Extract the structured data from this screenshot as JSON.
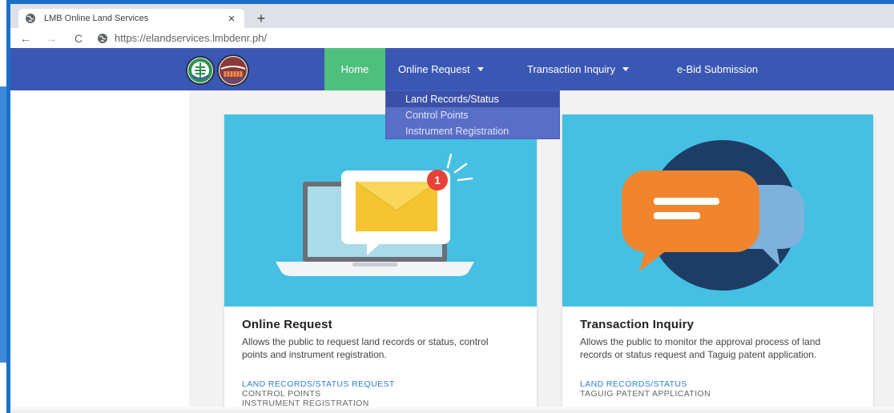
{
  "browser": {
    "tab_title": "LMB Online Land Services",
    "tab_close": "×",
    "new_tab": "+",
    "back": "←",
    "forward": "→",
    "reload": "C",
    "url": "https://elandservices.lmbdenr.ph/"
  },
  "navbar": {
    "home": "Home",
    "online_request": "Online Request",
    "transaction_inquiry": "Transaction Inquiry",
    "ebid": "e-Bid Submission"
  },
  "dropdown": {
    "items": [
      "Land Records/Status",
      "Control Points",
      "Instrument Registration"
    ]
  },
  "cards": [
    {
      "title": "Online Request",
      "description": "Allows the public to request land records or status, control points and instrument registration.",
      "badge": "1",
      "links": [
        "LAND RECORDS/STATUS REQUEST",
        "CONTROL POINTS",
        "INSTRUMENT REGISTRATION"
      ]
    },
    {
      "title": "Transaction Inquiry",
      "description": "Allows the public to monitor the approval process of land records or status request and Taguig patent application.",
      "links": [
        "LAND RECORDS/STATUS",
        "TAGUIG PATENT APPLICATION"
      ]
    }
  ],
  "colors": {
    "frame": "#1a6fc9",
    "navbar": "#3a57b3",
    "home_active": "#4fbf7e",
    "card_art": "#45c0e3",
    "link": "#2f7fd2"
  },
  "icons": {
    "tab": "globe-icon",
    "url": "site-info-icon",
    "card1": "laptop-mail-notification-icon",
    "card2": "chat-bubbles-icon"
  }
}
